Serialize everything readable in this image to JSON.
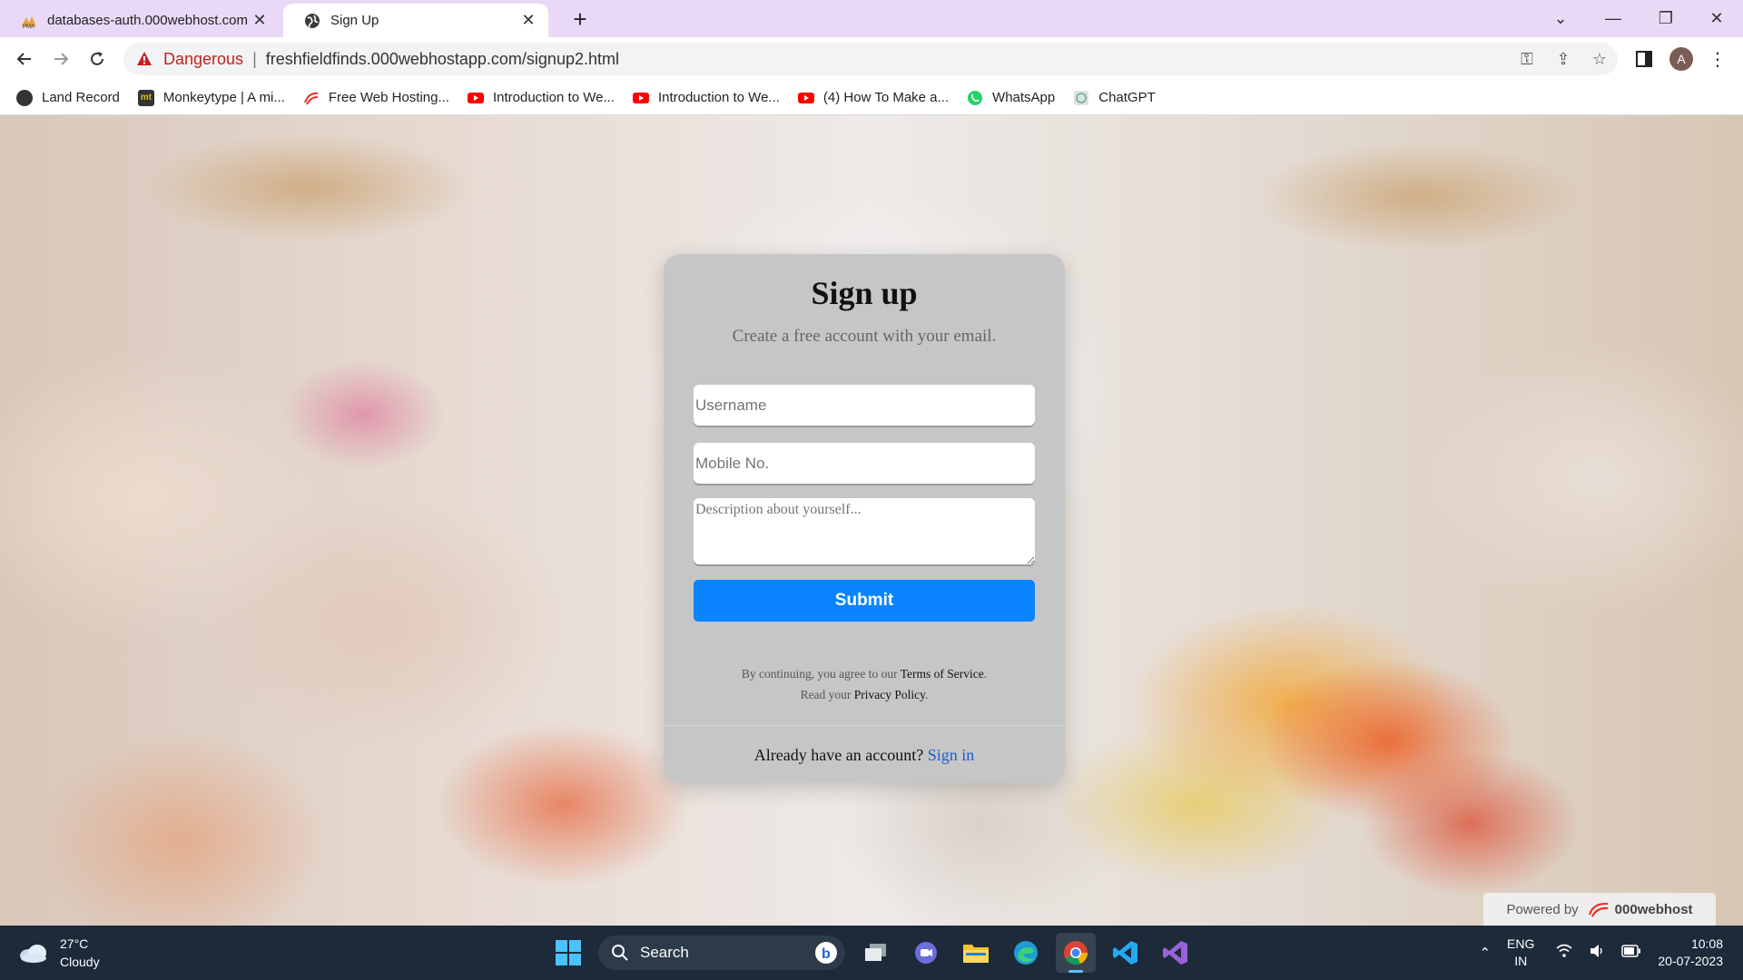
{
  "browser": {
    "tabs": [
      {
        "label": "databases-auth.000webhost.com",
        "icon": "phpmyadmin-icon",
        "active": false
      },
      {
        "label": "Sign Up",
        "icon": "globe-icon",
        "active": true
      }
    ],
    "security_label": "Dangerous",
    "url": "freshfieldfinds.000webhostapp.com/signup2.html",
    "profile_initial": "A",
    "bookmarks": [
      {
        "label": "Land Record",
        "icon": "globe-icon"
      },
      {
        "label": "Monkeytype | A mi...",
        "icon": "monkeytype-icon",
        "icon_text": "mt"
      },
      {
        "label": "Free Web Hosting...",
        "icon": "000webhost-icon"
      },
      {
        "label": "Introduction to We...",
        "icon": "youtube-icon"
      },
      {
        "label": "Introduction to We...",
        "icon": "youtube-icon"
      },
      {
        "label": "(4) How To Make a...",
        "icon": "youtube-icon"
      },
      {
        "label": "WhatsApp",
        "icon": "whatsapp-icon"
      },
      {
        "label": "ChatGPT",
        "icon": "chatgpt-icon"
      }
    ]
  },
  "signup": {
    "title": "Sign up",
    "subtitle": "Create a free account with your email.",
    "username_placeholder": "Username",
    "mobile_placeholder": "Mobile No.",
    "description_placeholder": "Description about yourself...",
    "submit_label": "Submit",
    "terms_prefix": "By continuing, you agree to our ",
    "terms_link": "Terms of Service",
    "terms_suffix": ".",
    "privacy_prefix": "Read your ",
    "privacy_link": "Privacy Policy",
    "privacy_suffix": ".",
    "account_prompt": "Already have an account? ",
    "signin_link": "Sign in",
    "accent_color": "#0a84ff"
  },
  "powered_by": {
    "prefix": "Powered by",
    "brand": "000webhost"
  },
  "taskbar": {
    "weather_temp": "27°C",
    "weather_desc": "Cloudy",
    "search_label": "Search",
    "apps": [
      "windows-start-icon",
      "bing-chat-icon",
      "task-view-icon",
      "teams-chat-icon",
      "file-explorer-icon",
      "edge-icon",
      "chrome-icon",
      "vscode-icon",
      "visual-studio-icon"
    ],
    "lang_line1": "ENG",
    "lang_line2": "IN",
    "time": "10:08",
    "date": "20-07-2023"
  }
}
